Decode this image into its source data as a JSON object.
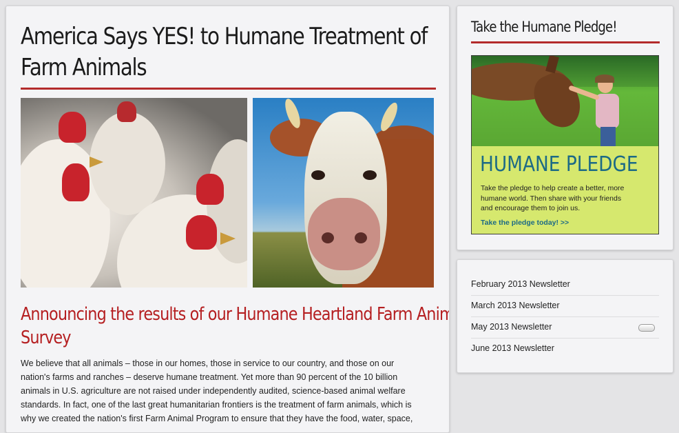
{
  "article": {
    "title": "America Says YES! to Humane Treatment of Farm Animals",
    "title_lines": [
      "America Says YES! to Humane Treatment of",
      "Farm Animals"
    ],
    "subtitle_lines": [
      "Announcing the results of our Humane Heartland Farm Animal",
      "Survey"
    ],
    "body_lines": [
      "We believe that all animals – those in our homes, those in service to our country, and those on our",
      "nation's farms and ranches – deserve humane treatment.  Yet more than 90 percent of the 10 billion",
      "animals in U.S. agriculture are not raised under independently audited, science-based animal welfare",
      "standards. In fact, one of the last great humanitarian frontiers is the treatment of farm animals, which is",
      "why we created the nation's first Farm Animal Program to ensure that they have the food, water, space,"
    ]
  },
  "sidebar": {
    "pledge_heading": "Take the Humane Pledge!",
    "ad": {
      "title": "HUMANE PLEDGE",
      "text_lines": [
        "Take the pledge to help create a better, more",
        "humane world. Then share with your friends",
        "and encourage them to join us."
      ],
      "cta": "Take the pledge today! >>"
    },
    "newsletters": [
      "February 2013 Newsletter",
      "March 2013 Newsletter",
      "May 2013 Newsletter",
      "June 2013 Newsletter"
    ]
  },
  "colors": {
    "accent_red": "#b32b2b",
    "subhead_red": "#b51f21",
    "ad_blue": "#1c6a86",
    "ad_green": "#d6e86e"
  }
}
